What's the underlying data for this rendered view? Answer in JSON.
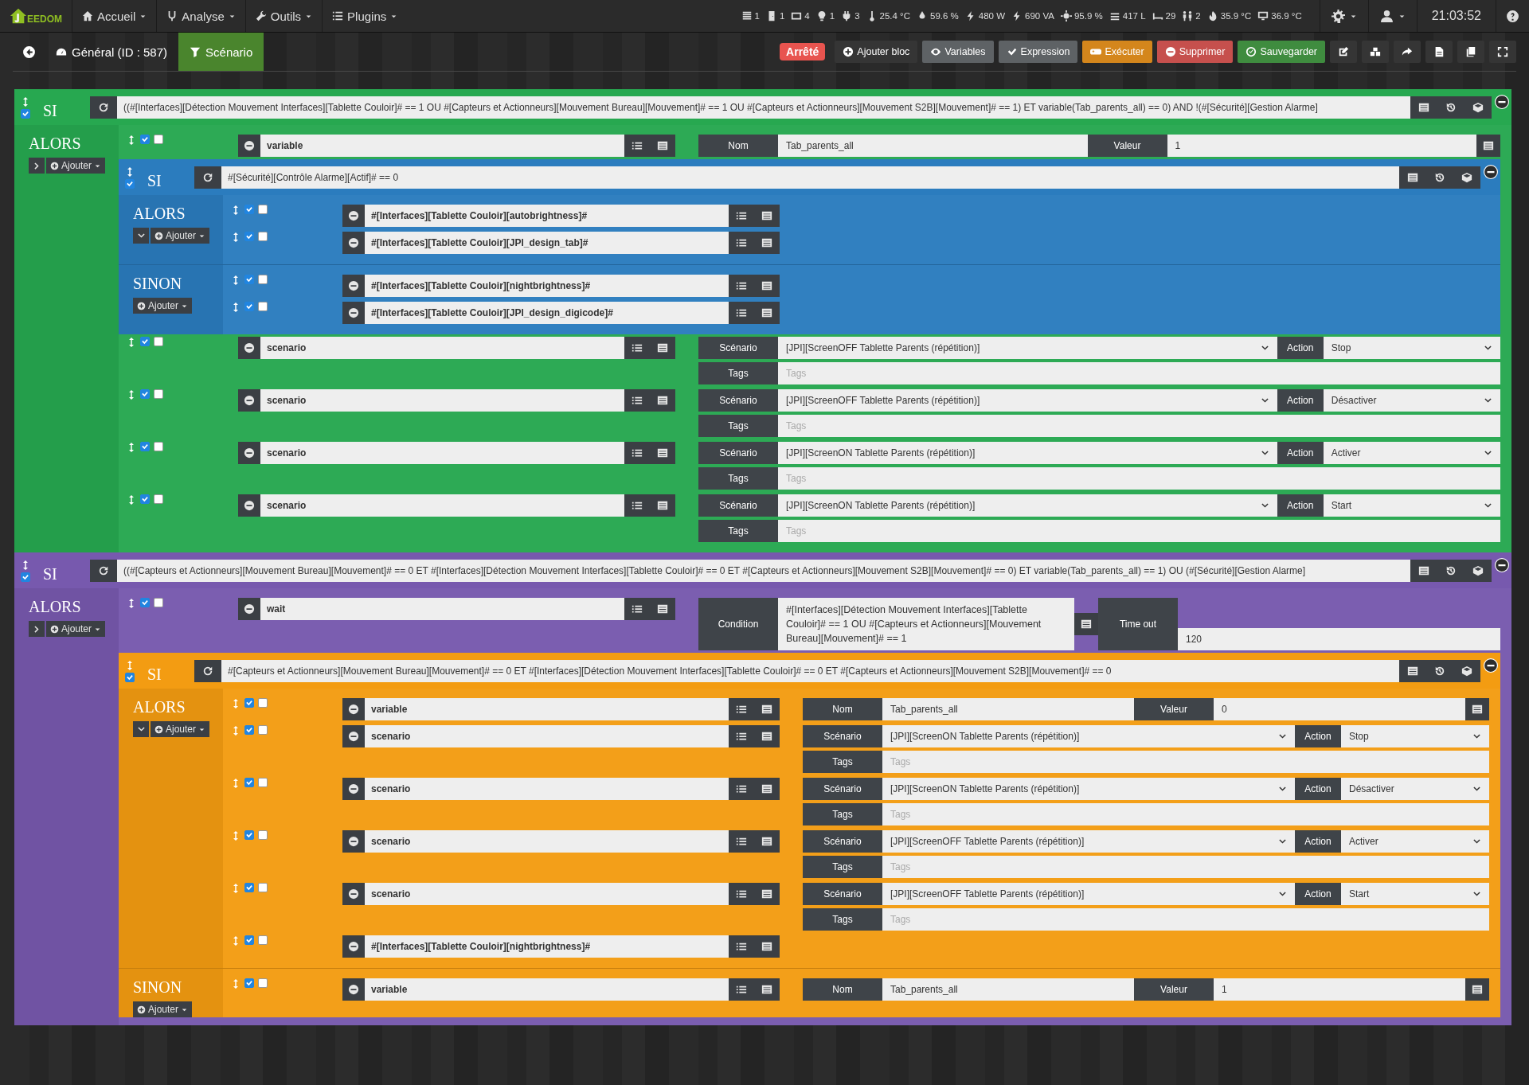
{
  "navbar": {
    "logo": "EEDOM",
    "menu": [
      {
        "label": "Accueil",
        "kind": "home"
      },
      {
        "label": "Analyse",
        "kind": "health"
      },
      {
        "label": "Outils",
        "kind": "tools"
      },
      {
        "label": "Plugins",
        "kind": "plugins"
      }
    ],
    "status": [
      {
        "kind": "shutter",
        "text": "1"
      },
      {
        "kind": "door",
        "text": "1"
      },
      {
        "kind": "window",
        "text": "4"
      },
      {
        "kind": "bulb",
        "text": "1"
      },
      {
        "kind": "plug",
        "text": "3"
      },
      {
        "kind": "thermo",
        "text": "25.4 °C"
      },
      {
        "kind": "drop",
        "text": "59.6 %"
      },
      {
        "kind": "bolt",
        "text": "480 W"
      },
      {
        "kind": "bolt",
        "text": "690 VA"
      },
      {
        "kind": "sun",
        "text": "95.9 %"
      },
      {
        "kind": "water",
        "text": "417 L"
      },
      {
        "kind": "bed",
        "text": "29"
      },
      {
        "kind": "people",
        "text": "2"
      },
      {
        "kind": "flame",
        "text": "35.9 °C"
      },
      {
        "kind": "computer",
        "text": "36.9 °C"
      }
    ],
    "time": "21:03:52"
  },
  "toolbar": {
    "tabs": [
      {
        "label": "Général (ID : 587)",
        "kind": "gauge",
        "selected": false
      },
      {
        "label": "Scénario",
        "kind": "filter",
        "selected": true
      }
    ],
    "state": {
      "text": "Arrêté",
      "kind": "stopped"
    },
    "buttons": [
      {
        "label": "Ajouter bloc",
        "kind": "add"
      },
      {
        "label": "Variables",
        "kind": "variables"
      },
      {
        "label": "Expression",
        "kind": "expression"
      },
      {
        "label": "Exécuter",
        "kind": "run"
      },
      {
        "label": "Supprimer",
        "kind": "delete"
      },
      {
        "label": "Sauvegarder",
        "kind": "save"
      }
    ]
  },
  "blocks": [
    {
      "kind": "block",
      "label": "SI",
      "enabled": true,
      "color": "#27a850",
      "condition": "((#[Interfaces][Détection Mouvement Interfaces][Tablette Couloir]# == 1 OU #[Capteurs et Actionneurs][Mouvement Bureau][Mouvement]# == 1 OU #[Capteurs et Actionneurs][Mouvement S2B][Mouvement]# == 1) ET variable(Tab_parents_all) == 0)  AND !(#[Sécurité][Gestion Alarme]",
      "sections": [
        {
          "label": "ALORS",
          "expanded": false,
          "add": "Ajouter",
          "actions": [
            {
              "kind": "action",
              "enabled": true,
              "parallel": false,
              "expression": "variable",
              "options": [
                [
                  {
                    "label": "Nom",
                    "kind": "text",
                    "value": "Tab_parents_all"
                  },
                  {
                    "label": "Valeur",
                    "kind": "text",
                    "value": "1",
                    "picker": true
                  }
                ]
              ]
            },
            {
              "kind": "block",
              "label": "SI",
              "enabled": true,
              "color": "#2b7cbe",
              "condition": "#[Sécurité][Contrôle Alarme][Actif]# == 0",
              "sections": [
                {
                  "label": "ALORS",
                  "expanded": true,
                  "add": "Ajouter",
                  "actions": [
                    {
                      "kind": "action",
                      "enabled": true,
                      "parallel": false,
                      "expression": "#[Interfaces][Tablette Couloir][autobrightness]#"
                    },
                    {
                      "kind": "action",
                      "enabled": true,
                      "parallel": false,
                      "expression": "#[Interfaces][Tablette Couloir][JPI_design_tab]#"
                    }
                  ]
                },
                {
                  "label": "SINON",
                  "add": "Ajouter",
                  "actions": [
                    {
                      "kind": "action",
                      "enabled": true,
                      "parallel": false,
                      "expression": "#[Interfaces][Tablette Couloir][nightbrightness]#"
                    },
                    {
                      "kind": "action",
                      "enabled": true,
                      "parallel": false,
                      "expression": "#[Interfaces][Tablette Couloir][JPI_design_digicode]#"
                    }
                  ]
                }
              ]
            },
            {
              "kind": "action",
              "enabled": true,
              "parallel": false,
              "expression": "scenario",
              "options": [
                [
                  {
                    "label": "Scénario",
                    "kind": "select",
                    "value": "[JPI][ScreenOFF Tablette Parents (répétition)]"
                  },
                  {
                    "label": "Action",
                    "kind": "select",
                    "value": "Stop"
                  }
                ],
                [
                  {
                    "label": "Tags",
                    "kind": "text",
                    "placeholder": "Tags"
                  }
                ]
              ]
            },
            {
              "kind": "action",
              "enabled": true,
              "parallel": false,
              "expression": "scenario",
              "options": [
                [
                  {
                    "label": "Scénario",
                    "kind": "select",
                    "value": "[JPI][ScreenOFF Tablette Parents (répétition)]"
                  },
                  {
                    "label": "Action",
                    "kind": "select",
                    "value": "Désactiver"
                  }
                ],
                [
                  {
                    "label": "Tags",
                    "kind": "text",
                    "placeholder": "Tags"
                  }
                ]
              ]
            },
            {
              "kind": "action",
              "enabled": true,
              "parallel": false,
              "expression": "scenario",
              "options": [
                [
                  {
                    "label": "Scénario",
                    "kind": "select",
                    "value": "[JPI][ScreenON Tablette Parents (répétition)]"
                  },
                  {
                    "label": "Action",
                    "kind": "select",
                    "value": "Activer"
                  }
                ],
                [
                  {
                    "label": "Tags",
                    "kind": "text",
                    "placeholder": "Tags"
                  }
                ]
              ]
            },
            {
              "kind": "action",
              "enabled": true,
              "parallel": false,
              "expression": "scenario",
              "options": [
                [
                  {
                    "label": "Scénario",
                    "kind": "select",
                    "value": "[JPI][ScreenON Tablette Parents (répétition)]"
                  },
                  {
                    "label": "Action",
                    "kind": "select",
                    "value": "Start"
                  }
                ],
                [
                  {
                    "label": "Tags",
                    "kind": "text",
                    "placeholder": "Tags"
                  }
                ]
              ]
            }
          ]
        }
      ]
    },
    {
      "kind": "block",
      "label": "SI",
      "enabled": true,
      "color": "#7759ae",
      "condition": "((#[Capteurs et Actionneurs][Mouvement Bureau][Mouvement]# == 0 ET #[Interfaces][Détection Mouvement Interfaces][Tablette Couloir]# == 0 ET #[Capteurs et Actionneurs][Mouvement S2B][Mouvement]# == 0) ET variable(Tab_parents_all) == 1) OU (#[Sécurité][Gestion Alarme]",
      "sections": [
        {
          "label": "ALORS",
          "expanded": false,
          "add": "Ajouter",
          "actions": [
            {
              "kind": "action",
              "enabled": true,
              "parallel": false,
              "expression": "wait",
              "options": [
                [
                  {
                    "label": "Condition",
                    "kind": "area",
                    "value": "#[Interfaces][Détection Mouvement Interfaces][Tablette Couloir]# == 1 OU #[Capteurs et Actionneurs][Mouvement Bureau][Mouvement]# == 1",
                    "picker": true
                  },
                  {
                    "label": "Time out",
                    "kind": "text",
                    "value": "120"
                  }
                ]
              ]
            },
            {
              "kind": "block",
              "label": "SI",
              "enabled": true,
              "color": "#f39c12",
              "condition": "#[Capteurs et Actionneurs][Mouvement Bureau][Mouvement]# == 0 ET #[Interfaces][Détection Mouvement Interfaces][Tablette Couloir]# == 0 ET #[Capteurs et Actionneurs][Mouvement S2B][Mouvement]# == 0",
              "sections": [
                {
                  "label": "ALORS",
                  "expanded": true,
                  "add": "Ajouter",
                  "actions": [
                    {
                      "kind": "action",
                      "enabled": true,
                      "parallel": false,
                      "expression": "variable",
                      "options": [
                        [
                          {
                            "label": "Nom",
                            "kind": "text",
                            "value": "Tab_parents_all"
                          },
                          {
                            "label": "Valeur",
                            "kind": "text",
                            "value": "0",
                            "picker": true
                          }
                        ]
                      ]
                    },
                    {
                      "kind": "action",
                      "enabled": true,
                      "parallel": false,
                      "expression": "scenario",
                      "options": [
                        [
                          {
                            "label": "Scénario",
                            "kind": "select",
                            "value": "[JPI][ScreenON Tablette Parents (répétition)]"
                          },
                          {
                            "label": "Action",
                            "kind": "select",
                            "value": "Stop"
                          }
                        ],
                        [
                          {
                            "label": "Tags",
                            "kind": "text",
                            "placeholder": "Tags"
                          }
                        ]
                      ]
                    },
                    {
                      "kind": "action",
                      "enabled": true,
                      "parallel": false,
                      "expression": "scenario",
                      "options": [
                        [
                          {
                            "label": "Scénario",
                            "kind": "select",
                            "value": "[JPI][ScreenON Tablette Parents (répétition)]"
                          },
                          {
                            "label": "Action",
                            "kind": "select",
                            "value": "Désactiver"
                          }
                        ],
                        [
                          {
                            "label": "Tags",
                            "kind": "text",
                            "placeholder": "Tags"
                          }
                        ]
                      ]
                    },
                    {
                      "kind": "action",
                      "enabled": true,
                      "parallel": false,
                      "expression": "scenario",
                      "options": [
                        [
                          {
                            "label": "Scénario",
                            "kind": "select",
                            "value": "[JPI][ScreenOFF Tablette Parents (répétition)]"
                          },
                          {
                            "label": "Action",
                            "kind": "select",
                            "value": "Activer"
                          }
                        ],
                        [
                          {
                            "label": "Tags",
                            "kind": "text",
                            "placeholder": "Tags"
                          }
                        ]
                      ]
                    },
                    {
                      "kind": "action",
                      "enabled": true,
                      "parallel": false,
                      "expression": "scenario",
                      "options": [
                        [
                          {
                            "label": "Scénario",
                            "kind": "select",
                            "value": "[JPI][ScreenOFF Tablette Parents (répétition)]"
                          },
                          {
                            "label": "Action",
                            "kind": "select",
                            "value": "Start"
                          }
                        ],
                        [
                          {
                            "label": "Tags",
                            "kind": "text",
                            "placeholder": "Tags"
                          }
                        ]
                      ]
                    },
                    {
                      "kind": "action",
                      "enabled": true,
                      "parallel": false,
                      "expression": "#[Interfaces][Tablette Couloir][nightbrightness]#"
                    }
                  ]
                },
                {
                  "label": "SINON",
                  "add": "Ajouter",
                  "actions": [
                    {
                      "kind": "action",
                      "enabled": true,
                      "parallel": false,
                      "expression": "variable",
                      "options": [
                        [
                          {
                            "label": "Nom",
                            "kind": "text",
                            "value": "Tab_parents_all"
                          },
                          {
                            "label": "Valeur",
                            "kind": "text",
                            "value": "1",
                            "picker": true
                          }
                        ]
                      ]
                    }
                  ]
                }
              ]
            }
          ]
        }
      ]
    }
  ]
}
